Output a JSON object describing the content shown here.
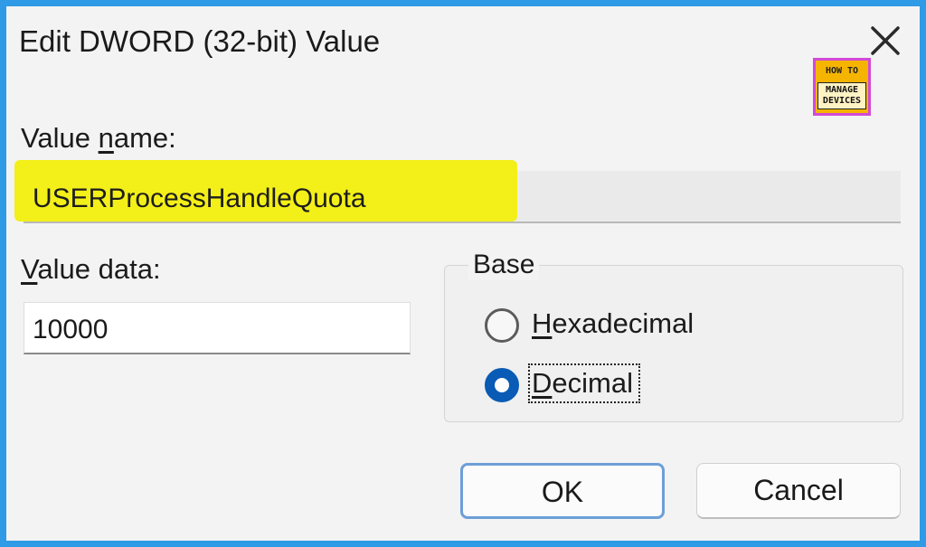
{
  "dialog": {
    "title": "Edit DWORD (32-bit) Value",
    "close_icon": "close-icon"
  },
  "logo": {
    "line1": "HOW TO",
    "line2": "MANAGE",
    "line3": "DEVICES",
    "border_color": "#d24ad6",
    "fill_color": "#f5b400"
  },
  "value_name": {
    "label_prefix": "Value ",
    "label_mnemonic": "n",
    "label_suffix": "ame:",
    "value": "USERProcessHandleQuota",
    "highlight_color": "#f3ef19"
  },
  "value_data": {
    "label_mnemonic": "V",
    "label_suffix": "alue data:",
    "value": "10000"
  },
  "base": {
    "legend": "Base",
    "options": [
      {
        "mnemonic": "H",
        "rest": "exadecimal",
        "selected": false
      },
      {
        "mnemonic": "D",
        "rest": "ecimal",
        "selected": true
      }
    ],
    "selected_color": "#0a5bb5"
  },
  "buttons": {
    "ok_label": "OK",
    "cancel_label": "Cancel"
  },
  "colors": {
    "frame": "#2f9ae6",
    "dialog_bg": "#f3f3f3",
    "ok_border": "#6d9fd8"
  }
}
